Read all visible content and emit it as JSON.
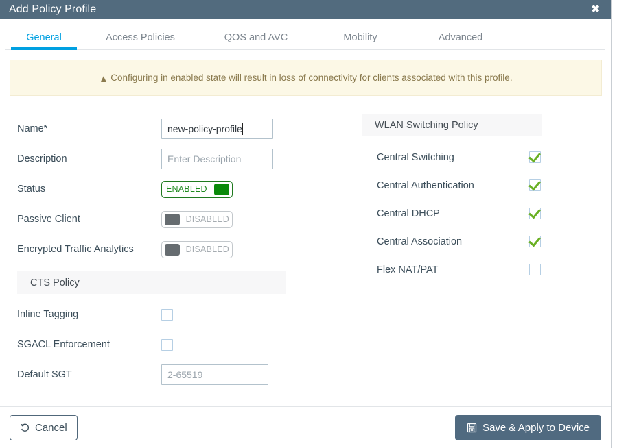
{
  "window": {
    "title": "Add Policy Profile",
    "close_icon": "close-icon"
  },
  "tabs": [
    {
      "label": "General",
      "active": true
    },
    {
      "label": "Access Policies",
      "active": false
    },
    {
      "label": "QOS and AVC",
      "active": false
    },
    {
      "label": "Mobility",
      "active": false
    },
    {
      "label": "Advanced",
      "active": false
    }
  ],
  "banner": {
    "icon": "warning-triangle-icon",
    "text": "Configuring in enabled state will result in loss of connectivity for clients associated with this profile."
  },
  "form": {
    "name": {
      "label": "Name*",
      "value": "new-policy-profile"
    },
    "description": {
      "label": "Description",
      "placeholder": "Enter Description"
    },
    "status": {
      "label": "Status",
      "state": "ENABLED"
    },
    "passive_client": {
      "label": "Passive Client",
      "state": "DISABLED"
    },
    "encrypted_traffic_analytics": {
      "label": "Encrypted Traffic Analytics",
      "state": "DISABLED"
    }
  },
  "cts_policy": {
    "title": "CTS Policy",
    "inline_tagging": {
      "label": "Inline Tagging",
      "checked": false
    },
    "sgacl_enforcement": {
      "label": "SGACL Enforcement",
      "checked": false
    },
    "default_sgt": {
      "label": "Default SGT",
      "placeholder": "2-65519"
    }
  },
  "wlan_switching_policy": {
    "title": "WLAN Switching Policy",
    "items": [
      {
        "label": "Central Switching",
        "checked": true
      },
      {
        "label": "Central Authentication",
        "checked": true
      },
      {
        "label": "Central DHCP",
        "checked": true
      },
      {
        "label": "Central Association",
        "checked": true
      },
      {
        "label": "Flex NAT/PAT",
        "checked": false
      }
    ]
  },
  "footer": {
    "cancel_label": "Cancel",
    "cancel_icon": "undo-arrow-icon",
    "save_label": "Save & Apply to Device",
    "save_icon": "save-disk-icon"
  },
  "colors": {
    "titlebar": "#526b7e",
    "accent_blue": "#00a0e1",
    "banner_bg": "#fcf8e6",
    "banner_text": "#8a7a4e",
    "toggle_on_green": "#0a8a0a",
    "check_green": "#6ab023",
    "save_button": "#506a80"
  }
}
